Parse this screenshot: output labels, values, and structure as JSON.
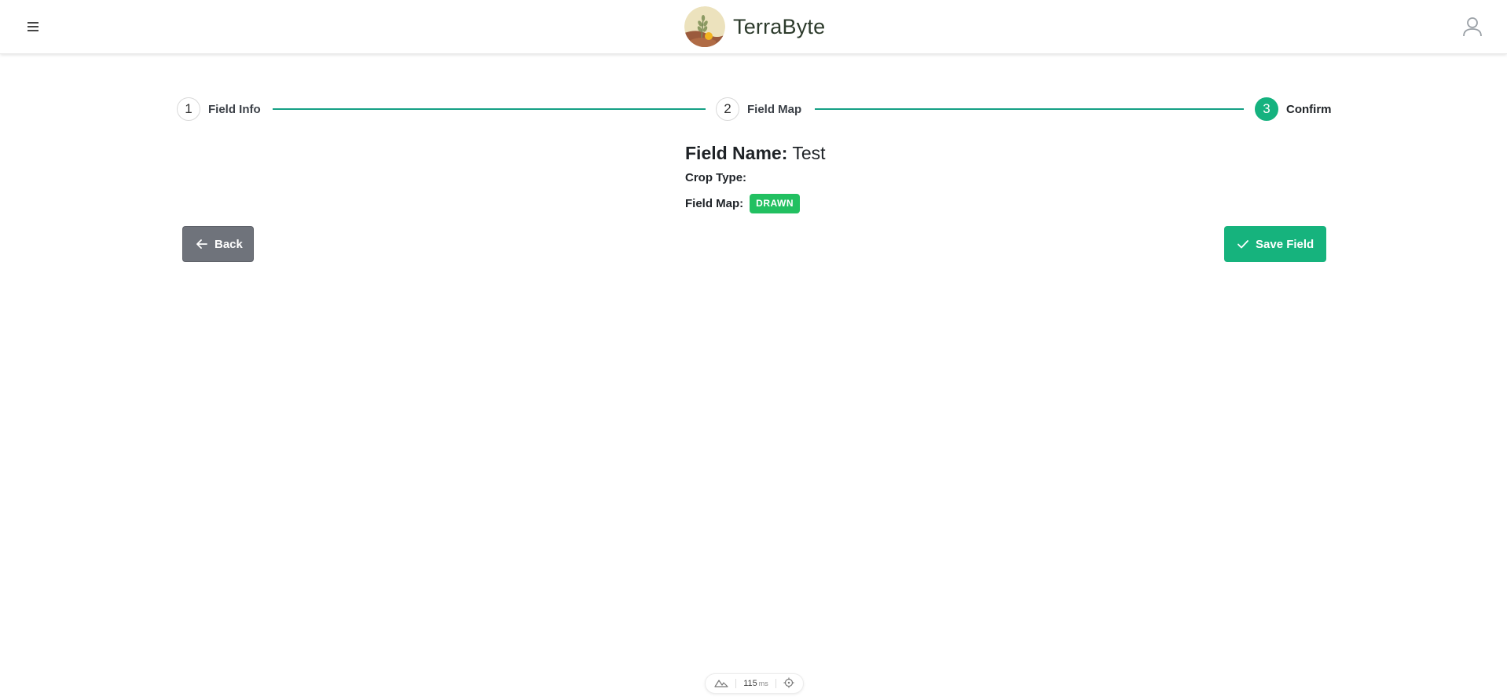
{
  "app": {
    "brand_name": "TerraByte"
  },
  "stepper": {
    "steps": [
      {
        "number": "1",
        "label": "Field Info",
        "active": false
      },
      {
        "number": "2",
        "label": "Field Map",
        "active": false
      },
      {
        "number": "3",
        "label": "Confirm",
        "active": true
      }
    ],
    "line_color": "#15a085",
    "active_color": "#15b27f"
  },
  "summary": {
    "field_name_label": "Field Name:",
    "field_name_value": "Test",
    "crop_type_label": "Crop Type:",
    "crop_type_value": "",
    "field_map_label": "Field Map:",
    "field_map_status": "DRAWN"
  },
  "actions": {
    "back_label": "Back",
    "save_label": "Save Field"
  },
  "devbar": {
    "latency_value": "115",
    "latency_unit": "ms"
  },
  "icons": {
    "menu": "hamburger-menu-icon",
    "user": "user-icon",
    "back": "arrow-left-icon",
    "save": "check-icon",
    "devbar_left": "mountain-icon",
    "devbar_right": "crosshair-icon"
  },
  "colors": {
    "badge": "#22c061",
    "back_button": "#6f737b",
    "save_button": "#16b37d"
  }
}
